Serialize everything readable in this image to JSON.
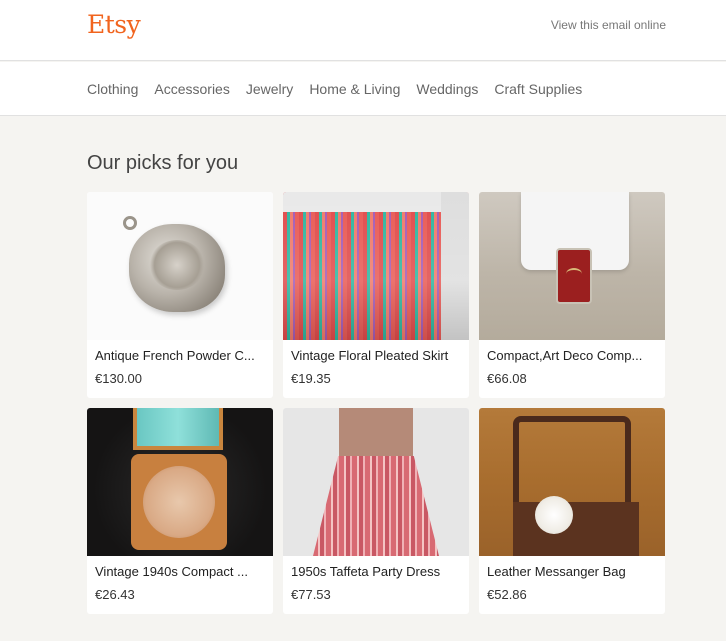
{
  "header": {
    "logo": "Etsy",
    "view_online": "View this email online"
  },
  "nav": {
    "items": [
      "Clothing",
      "Accessories",
      "Jewelry",
      "Home & Living",
      "Weddings",
      "Craft Supplies"
    ]
  },
  "section": {
    "title": "Our picks for you"
  },
  "products": [
    {
      "title": "Antique French Powder C...",
      "price": "€130.00"
    },
    {
      "title": "Vintage Floral Pleated Skirt",
      "price": "€19.35"
    },
    {
      "title": "Compact,Art Deco Comp...",
      "price": "€66.08"
    },
    {
      "title": "Vintage 1940s Compact ...",
      "price": "€26.43"
    },
    {
      "title": "1950s Taffeta Party Dress",
      "price": "€77.53"
    },
    {
      "title": "Leather Messanger Bag",
      "price": "€52.86"
    }
  ],
  "colors": {
    "brand": "#f1641e",
    "background": "#f5f4f1"
  }
}
